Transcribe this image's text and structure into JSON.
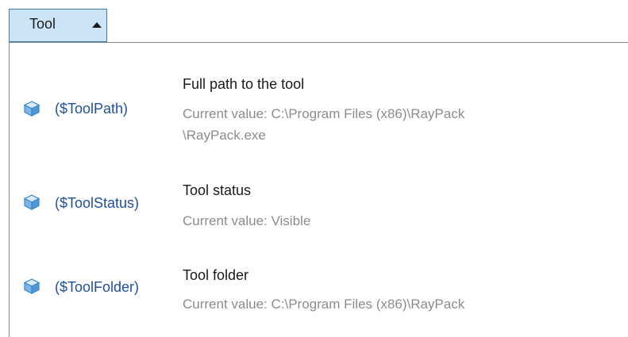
{
  "dropdown": {
    "label": "Tool",
    "arrow_icon": "triangle-up-icon"
  },
  "items": [
    {
      "variable": "($ToolPath)",
      "title": "Full path to the tool",
      "value_line1": "Current value: C:\\Program Files (x86)\\RayPack",
      "value_line2": "\\RayPack.exe",
      "icon": "cube-icon"
    },
    {
      "variable": "($ToolStatus)",
      "title": "Tool status",
      "value_line1": "Current value: Visible",
      "icon": "cube-icon"
    },
    {
      "variable": "($ToolFolder)",
      "title": "Tool folder",
      "value_line1": "Current value: C:\\Program Files (x86)\\RayPack",
      "icon": "cube-icon"
    }
  ],
  "colors": {
    "button_bg": "#cce4f7",
    "button_border": "#3c7fb1",
    "variable_text": "#1f4f9e",
    "secondary_text": "#8c8c8c"
  }
}
